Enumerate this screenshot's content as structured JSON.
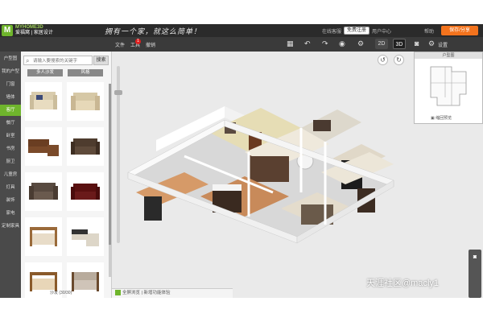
{
  "header": {
    "logo_letter": "M",
    "brand_name": "MYHOME3D",
    "brand_sub": "爱福窝 | 家居设计",
    "slogan": "拥有一个家，就这么简单！",
    "links": [
      "在线客服",
      "注册/登录",
      "用户中心",
      "帮助"
    ],
    "register_label": "免费注册",
    "save_label": "保存/分享"
  },
  "toolbar": {
    "items": [
      "文件",
      "工具",
      "撤销"
    ],
    "badge": "1",
    "icons": [
      "grid-icon",
      "undo-icon",
      "redo-icon",
      "eye-icon",
      "settings-icon"
    ],
    "view_2d": "2D",
    "view_3d": "3D",
    "settings_label": "设置"
  },
  "leftnav": {
    "items": [
      "户型图",
      "我的户型",
      "门窗",
      "墙体",
      "客厅",
      "餐厅",
      "卧室",
      "书房",
      "厨卫",
      "儿童房",
      "灯具",
      "装饰",
      "家电",
      "定制家具"
    ],
    "active_index": 4
  },
  "catalog": {
    "search_placeholder": "请输入要搜索的关键字",
    "search_button": "搜索",
    "filters": [
      "多人沙发",
      "风格"
    ],
    "footer": "沙发 (30/30)",
    "products": [
      "sofa-cream",
      "sofa-cream-2",
      "sofa-brown-l",
      "sofa-brown",
      "sofa-dark",
      "sofa-red",
      "sofa-wood",
      "sofa-corner",
      "sofa-wood-2",
      "sofa-fabric"
    ]
  },
  "canvas": {
    "bottom_text": "全屏浏览 | 新增功能体验",
    "controls": [
      "rotate-left-icon",
      "rotate-right-icon"
    ]
  },
  "minimap": {
    "title": "户型图",
    "button": "缩回预览"
  },
  "watermark": "天涯社区@macly1",
  "colors": {
    "accent_green": "#6fb52c",
    "save_orange": "#f3731d",
    "toolbar_dark": "#3a3a3a"
  }
}
